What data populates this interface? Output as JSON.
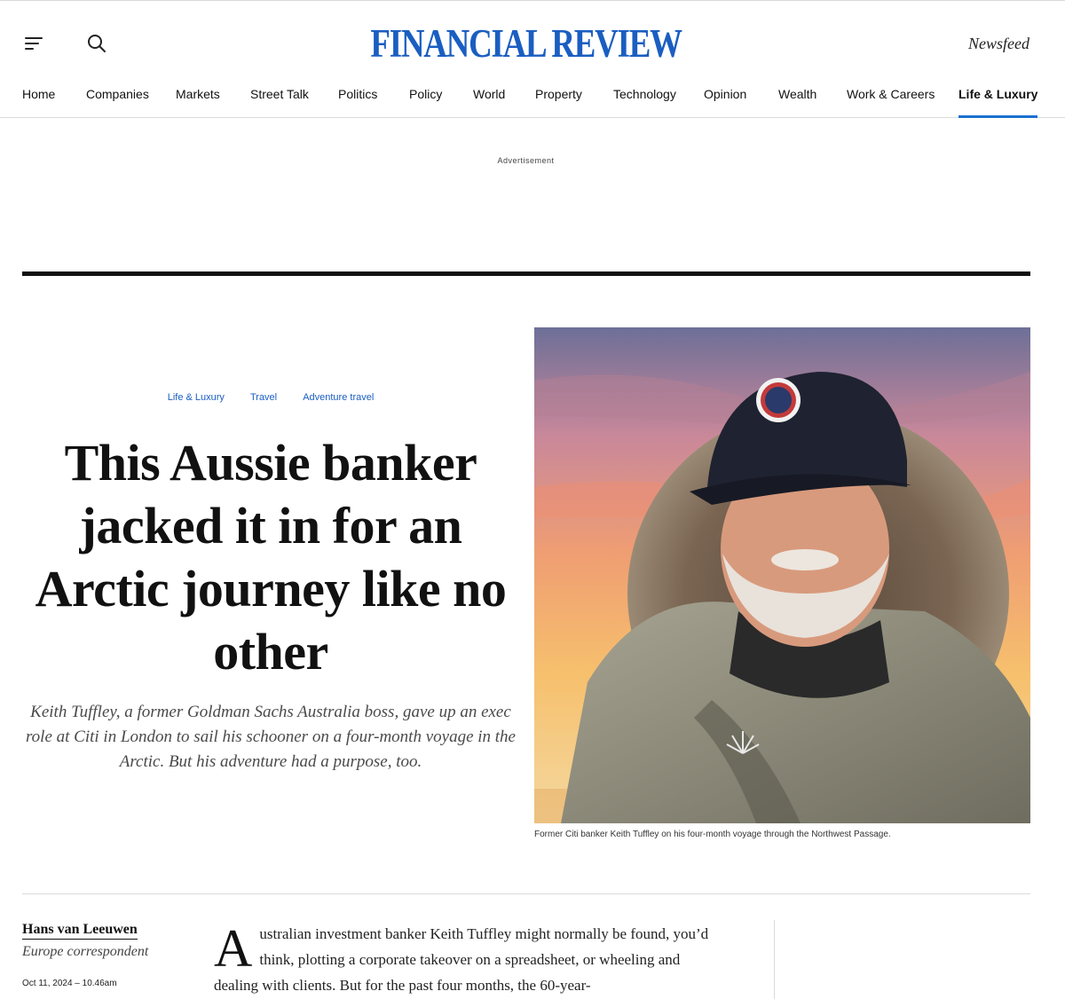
{
  "header": {
    "brand": "FINANCIAL REVIEW",
    "newsfeed": "Newsfeed",
    "accent_color": "#1a5ec1",
    "icons": [
      "menu-icon",
      "search-icon"
    ]
  },
  "nav": {
    "items": [
      {
        "label": "Home"
      },
      {
        "label": "Companies"
      },
      {
        "label": "Markets"
      },
      {
        "label": "Street Talk"
      },
      {
        "label": "Politics"
      },
      {
        "label": "Policy"
      },
      {
        "label": "World"
      },
      {
        "label": "Property"
      },
      {
        "label": "Technology"
      },
      {
        "label": "Opinion"
      },
      {
        "label": "Wealth"
      },
      {
        "label": "Work & Careers"
      },
      {
        "label": "Life & Luxury",
        "active": true
      }
    ]
  },
  "ad": {
    "label": "Advertisement"
  },
  "article": {
    "breadcrumbs": [
      "Life & Luxury",
      "Travel",
      "Adventure travel"
    ],
    "headline": "This Aussie banker jacked it in for an Arctic journey like no other",
    "standfirst": "Keith Tuffley, a former Goldman Sachs Australia boss, gave up an exec role at Citi in London to sail his schooner on a four-month voyage in the Arctic. But his adventure had a purpose, too.",
    "image_caption": "Former Citi banker Keith Tuffley on his four-month voyage through the Northwest Passage.",
    "author": "Hans van Leeuwen",
    "author_role": "Europe correspondent",
    "date": "Oct 11, 2024 – 10.46am",
    "dropcap": "A",
    "body_first": "ustralian investment banker Keith Tuffley might normally be found, you’d think, plotting a corporate takeover on a spreadsheet, or wheeling and dealing with clients. But for the past four months, the 60-year-"
  }
}
